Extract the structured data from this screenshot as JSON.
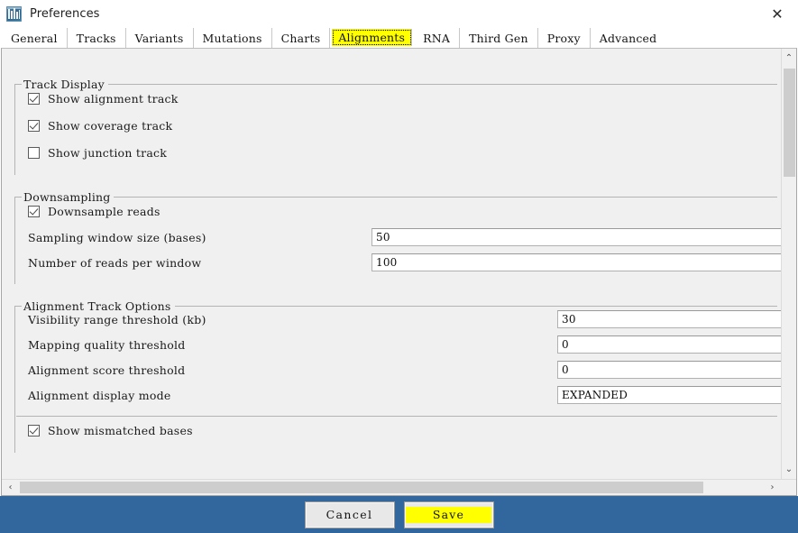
{
  "window": {
    "title": "Preferences",
    "icon": "igv-app-icon",
    "close_label": "✕"
  },
  "tabs": [
    {
      "label": "General",
      "selected": false
    },
    {
      "label": "Tracks",
      "selected": false
    },
    {
      "label": "Variants",
      "selected": false
    },
    {
      "label": "Mutations",
      "selected": false
    },
    {
      "label": "Charts",
      "selected": false
    },
    {
      "label": "Alignments",
      "selected": true
    },
    {
      "label": "RNA",
      "selected": false
    },
    {
      "label": "Third Gen",
      "selected": false
    },
    {
      "label": "Proxy",
      "selected": false
    },
    {
      "label": "Advanced",
      "selected": false
    }
  ],
  "groups": {
    "track_display": {
      "title": "Track Display",
      "checkboxes": [
        {
          "label": "Show alignment track",
          "checked": true
        },
        {
          "label": "Show coverage track",
          "checked": true
        },
        {
          "label": "Show junction track",
          "checked": false
        }
      ]
    },
    "downsampling": {
      "title": "Downsampling",
      "checkbox": {
        "label": "Downsample reads",
        "checked": true
      },
      "fields": [
        {
          "label": "Sampling window size (bases)",
          "value": "50"
        },
        {
          "label": "Number of reads per window",
          "value": "100"
        }
      ]
    },
    "alignment_track_options": {
      "title": "Alignment Track Options",
      "fields": [
        {
          "label": "Visibility range threshold (kb)",
          "value": "30"
        },
        {
          "label": "Mapping quality threshold",
          "value": "0"
        },
        {
          "label": "Alignment score threshold",
          "value": "0"
        },
        {
          "label": "Alignment display mode",
          "value": "EXPANDED"
        }
      ],
      "clipped_checkbox": {
        "label": "Show mismatched bases",
        "checked": true
      }
    }
  },
  "scrollbars": {
    "vertical": {
      "up_arrow": "⌃",
      "down_arrow": "⌄"
    },
    "horizontal": {
      "left_arrow": "‹",
      "right_arrow": "›"
    }
  },
  "buttons": {
    "cancel": "Cancel",
    "save": "Save"
  },
  "colors": {
    "accent_bar": "#32679e",
    "highlight": "#ffff00",
    "panel": "#f0f0f0",
    "scroll_thumb": "#cdcdcd"
  }
}
